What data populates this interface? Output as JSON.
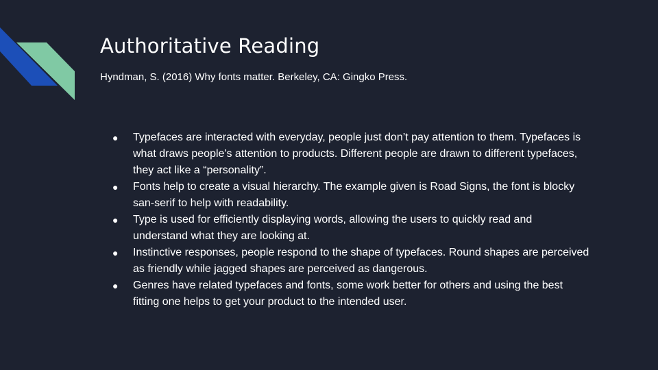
{
  "slide": {
    "title": "Authoritative Reading",
    "citation": "Hyndman, S. (2016) Why fonts matter. Berkeley, CA: Gingko Press.",
    "bullet_symbol": "●",
    "bullets": [
      "Typefaces are interacted with everyday, people just don’t pay attention to them. Typefaces is what draws people's attention to products. Different people are drawn to different typefaces, they act like a “personality”.",
      "Fonts help to create a visual hierarchy. The example given is Road Signs, the font is blocky san-serif to help with readability.",
      "Type is used for efficiently displaying words, allowing the users to quickly read and understand what they are looking at.",
      "Instinctive responses, people respond to the shape of typefaces. Round shapes are perceived as friendly while jagged shapes are perceived as dangerous.",
      "Genres have related typefaces and fonts, some work better for others and using the best fitting one helps to get your product to the intended user."
    ]
  },
  "colors": {
    "background": "#1d2230",
    "text": "#ffffff",
    "accent_blue": "#1c4fb8",
    "accent_green": "#80c9a4"
  }
}
